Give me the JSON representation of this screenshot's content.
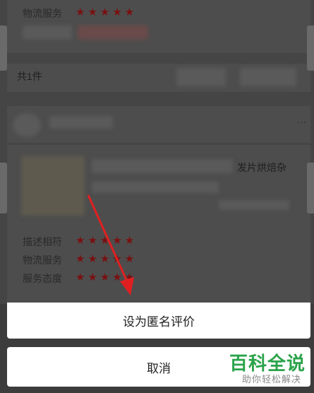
{
  "background": {
    "logistics_label_top": "物流服务",
    "item_count_text": "共1件",
    "product_title_fragment": "发片烘焙杂",
    "ratings": [
      {
        "label": "描述相符",
        "stars": 5
      },
      {
        "label": "物流服务",
        "stars": 5
      },
      {
        "label": "服务态度",
        "stars": 5
      }
    ]
  },
  "sheet": {
    "anonymous_label": "设为匿名评价",
    "cancel_label": "取消"
  },
  "watermark": {
    "title": "百科全说",
    "subtitle": "助你轻松解决"
  },
  "colors": {
    "star": "#7a1010",
    "watermark_green": "#2aa34a",
    "arrow_red": "#e02020"
  }
}
